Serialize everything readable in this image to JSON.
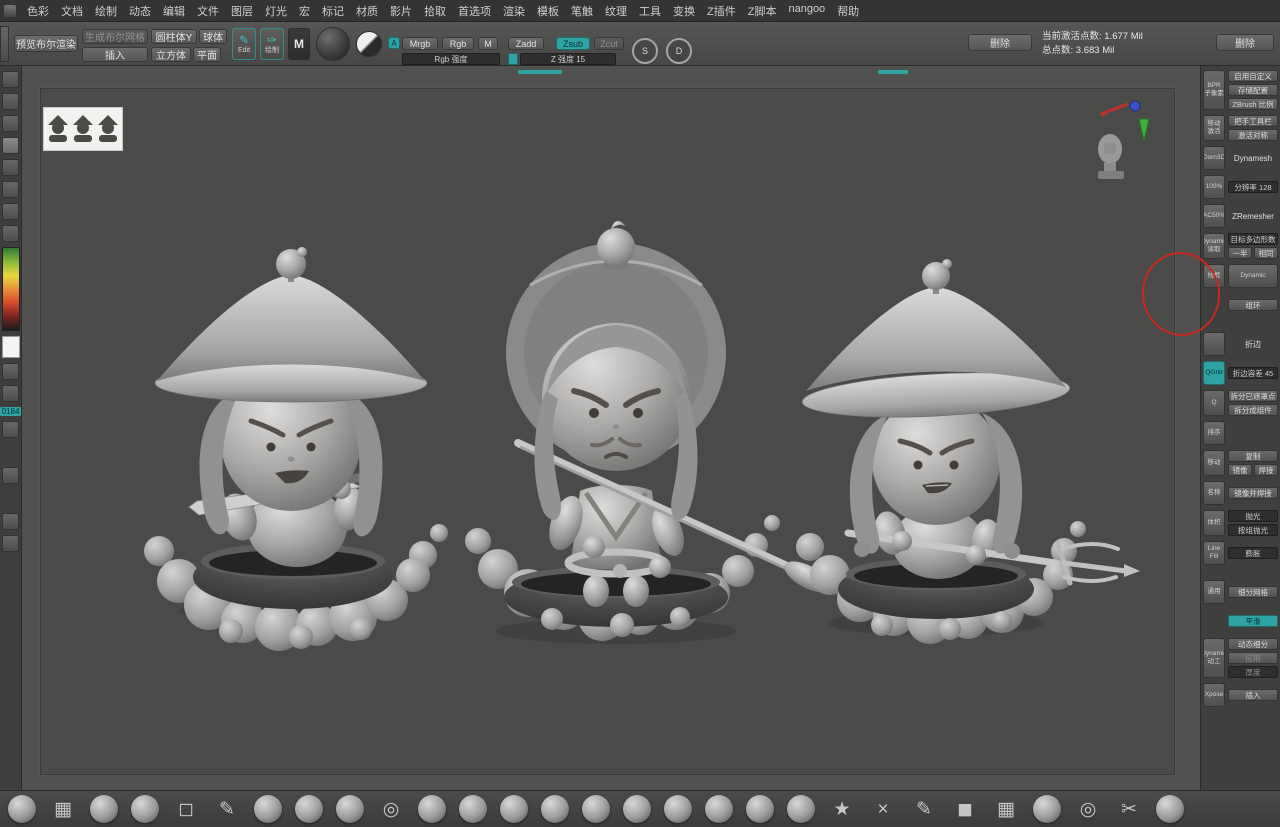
{
  "app": {
    "accent": "#2fa3a4"
  },
  "menubar": {
    "items": [
      "色彩",
      "文档",
      "绘制",
      "动态",
      "编辑",
      "文件",
      "图层",
      "灯光",
      "宏",
      "标记",
      "材质",
      "影片",
      "拾取",
      "首选项",
      "渲染",
      "模板",
      "笔触",
      "纹理",
      "工具",
      "变换",
      "Z插件",
      "Z脚本",
      "nangoo",
      "帮助"
    ]
  },
  "toolbar": {
    "preview_boolean": "预览布尔渲染",
    "generate_boolean": "生成布尔网格",
    "insert": "插入",
    "cylinder_y": "圆柱体Y",
    "sphere": "球体",
    "cube": "立方体",
    "plane": "平面",
    "edit": "Edit",
    "draw": "绘制",
    "m_mode": "M",
    "a_toggle": "A",
    "mrgb": "Mrgb",
    "rgb": "Rgb",
    "m": "M",
    "rgb_intensity": "Rgb 强度",
    "zadd": "Zadd",
    "zsub": "Zsub",
    "zcut": "Zcut",
    "z_intensity": "Z 强度 15",
    "stroke_s": "S",
    "stroke_d": "D",
    "delete_left": "删除",
    "active_points": "当前激活点数: 1.677 Mil",
    "total_points": "总点数: 3.683 Mil",
    "delete_right": "删除"
  },
  "left_tray": {
    "counter": "0184"
  },
  "right_panel": {
    "bpr": "BPR",
    "subpixel": "子像素",
    "enable_custom": "启用自定义",
    "store_config": "存储配置",
    "zbrush_scale": "ZBrush 比例",
    "transpose_icon": "移动",
    "activate_sub": "激活",
    "gizmo_toolbar": "把手工具栏",
    "activate_symmetry": "激活对称",
    "dorn3d": "Dorn3D",
    "dynamesh": "Dynamesh",
    "pct100": "100%",
    "resolution": "分辨率 128",
    "ac50": "AC50%",
    "zremesher": "ZRemesher",
    "dynamic_a": "Dynamic",
    "read": "读取",
    "target_poly": "目标多边形数",
    "half": "一半",
    "same": "相同",
    "wireframe": "线框",
    "dynamic_b": "Dynamic",
    "group_loops": "组环",
    "crease": "折边",
    "qgrid": "QGrid",
    "crease_tolerance": "折边容差 45",
    "q": "Q",
    "split_masked": "拆分已遮罩点",
    "split_parts": "拆分成组件",
    "sort_icon": "排序",
    "move_icon": "移动",
    "duplicate": "复制",
    "mirror": "镜像",
    "weld": "焊接",
    "name_icon": "名称",
    "mirror_weld": "镜像并焊接",
    "volume_icon": "体积",
    "polish": "抛光",
    "polish_group": "按组抛光",
    "line_fill": "Line Fill",
    "inflate": "膨胀",
    "brush_icon": "通用",
    "divide": "细分网格",
    "smooth": "平滑",
    "dynamic_c": "Dynamic",
    "dyn_sub_icon": "动工",
    "dynamic_subdiv": "动态细分",
    "apply": "应用",
    "thickness": "厚度",
    "xpose": "Xpose",
    "insert": "插入"
  },
  "bottom_bar": {
    "icons": [
      {
        "name": "standard-brush-icon"
      },
      {
        "name": "polymesh-cube-icon",
        "glyph": "▦",
        "cls": "glyph-icon"
      },
      {
        "name": "clay-brush-icon"
      },
      {
        "name": "move-brush-icon"
      },
      {
        "name": "select-rect-icon",
        "glyph": "◻",
        "cls": "glyph-icon"
      },
      {
        "name": "mask-pen-icon",
        "glyph": "✎",
        "cls": "glyph-icon"
      },
      {
        "name": "smooth-brush-icon"
      },
      {
        "name": "inflate-brush-icon"
      },
      {
        "name": "pinch-brush-icon"
      },
      {
        "name": "spiral-brush-icon",
        "glyph": "◎",
        "cls": "glyph-icon"
      },
      {
        "name": "crease-brush-icon"
      },
      {
        "name": "dam-standard-brush-icon"
      },
      {
        "name": "polish-brush-icon"
      },
      {
        "name": "trim-brush-icon"
      },
      {
        "name": "planar-brush-icon"
      },
      {
        "name": "form-brush-icon"
      },
      {
        "name": "blob-brush-icon"
      },
      {
        "name": "snakehook-brush-icon"
      },
      {
        "name": "clay-tube-brush-icon"
      },
      {
        "name": "nudge-brush-icon"
      },
      {
        "name": "star-brush-icon",
        "glyph": "★",
        "cls": "glyph-icon"
      },
      {
        "name": "cross-brush-icon",
        "glyph": "×",
        "cls": "glyph-icon"
      },
      {
        "name": "knife-brush-icon",
        "glyph": "✎",
        "cls": "glyph-icon"
      },
      {
        "name": "cube-primitive-icon",
        "glyph": "◼",
        "cls": "glyph-icon"
      },
      {
        "name": "mesh-cube-icon",
        "glyph": "▦",
        "cls": "glyph-icon"
      },
      {
        "name": "sphere-primitive-icon"
      },
      {
        "name": "ring-primitive-icon",
        "glyph": "◎",
        "cls": "glyph-icon"
      },
      {
        "name": "scissors-tool-icon",
        "glyph": "✂",
        "cls": "glyph-icon"
      },
      {
        "name": "drop-sphere-icon"
      }
    ]
  }
}
